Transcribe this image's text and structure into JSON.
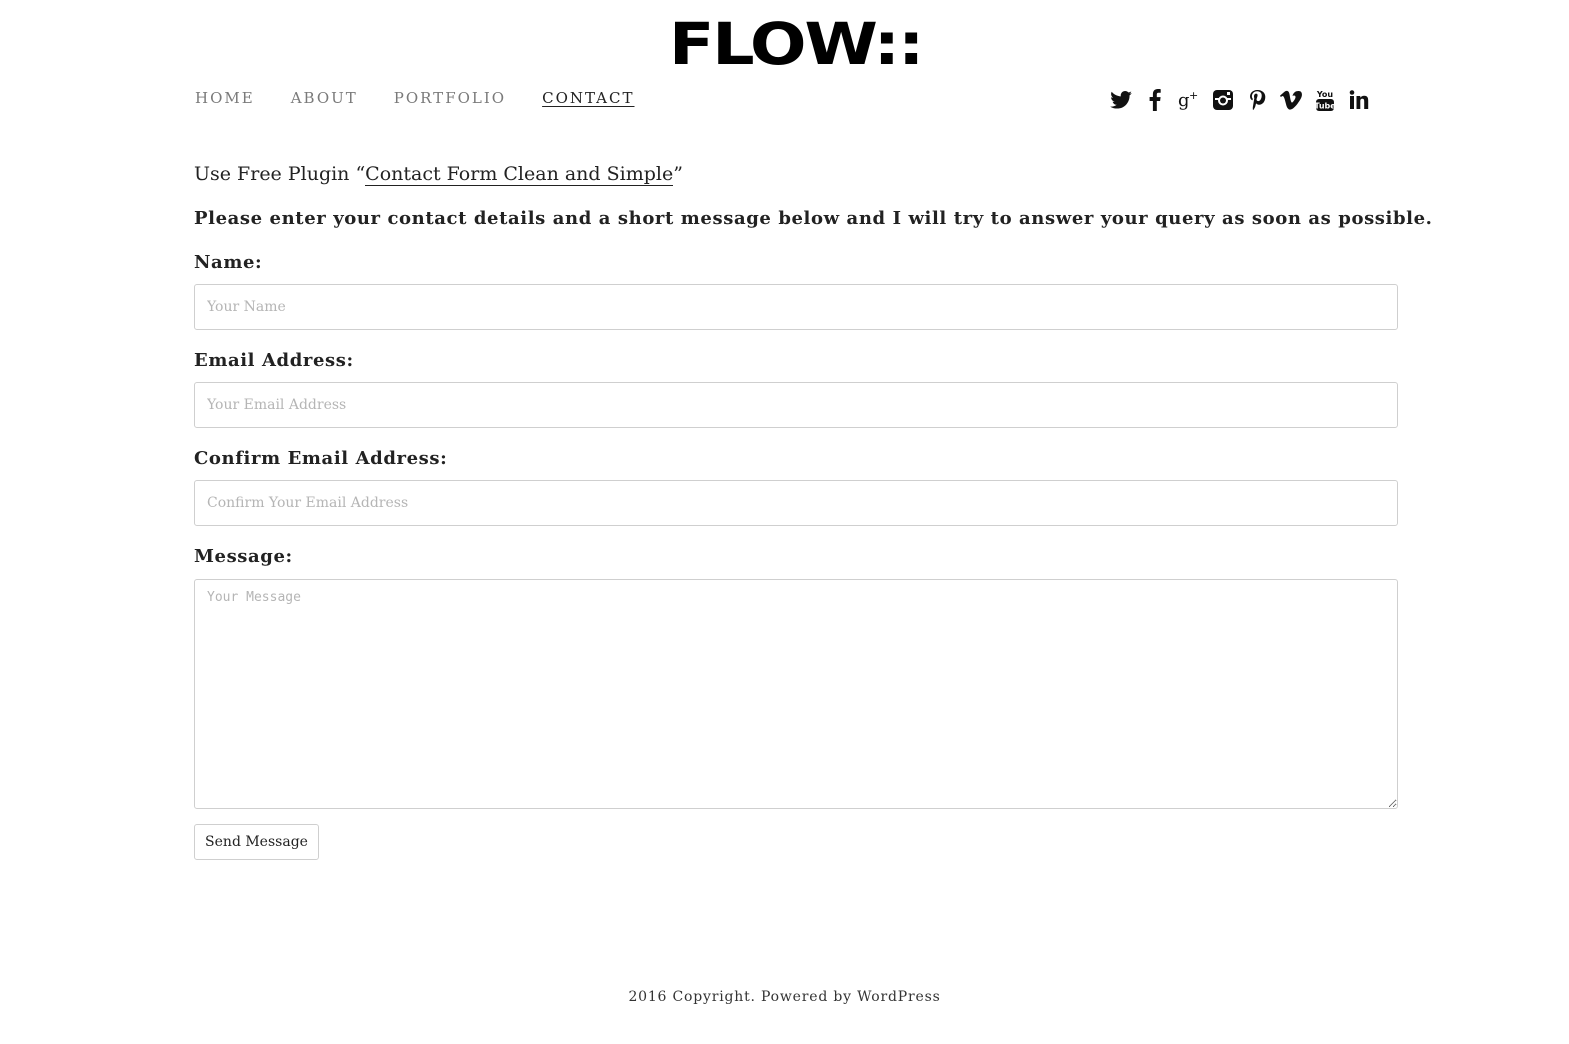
{
  "site": {
    "logo_text": "FLOW::"
  },
  "nav": {
    "items": [
      {
        "label": "HOME"
      },
      {
        "label": "ABOUT"
      },
      {
        "label": "PORTFOLIO"
      },
      {
        "label": "CONTACT",
        "active": true
      }
    ]
  },
  "social": {
    "icons": [
      "twitter-icon",
      "facebook-icon",
      "google-plus-icon",
      "instagram-icon",
      "pinterest-icon",
      "vimeo-icon",
      "youtube-icon",
      "linkedin-icon"
    ],
    "youtube_text_top": "You",
    "youtube_text_bottom": "Tube"
  },
  "content": {
    "intro_prefix": "Use Free Plugin “",
    "intro_link": "Contact Form Clean and Simple",
    "intro_suffix": "”",
    "lead": "Please enter your contact details and a short message below and I will try to answer your query as soon as possible."
  },
  "form": {
    "name_label": "Name:",
    "name_placeholder": "Your Name",
    "email_label": "Email Address:",
    "email_placeholder": "Your Email Address",
    "confirm_label": "Confirm Email Address:",
    "confirm_placeholder": "Confirm Your Email Address",
    "message_label": "Message:",
    "message_placeholder": "Your Message",
    "submit_label": "Send Message"
  },
  "footer": {
    "text": "2016 Copyright. Powered by WordPress"
  },
  "colors": {
    "nav_inactive": "#7a7a7a",
    "text": "#222222",
    "border": "#cfcfcf",
    "placeholder": "#b5b5b5"
  }
}
